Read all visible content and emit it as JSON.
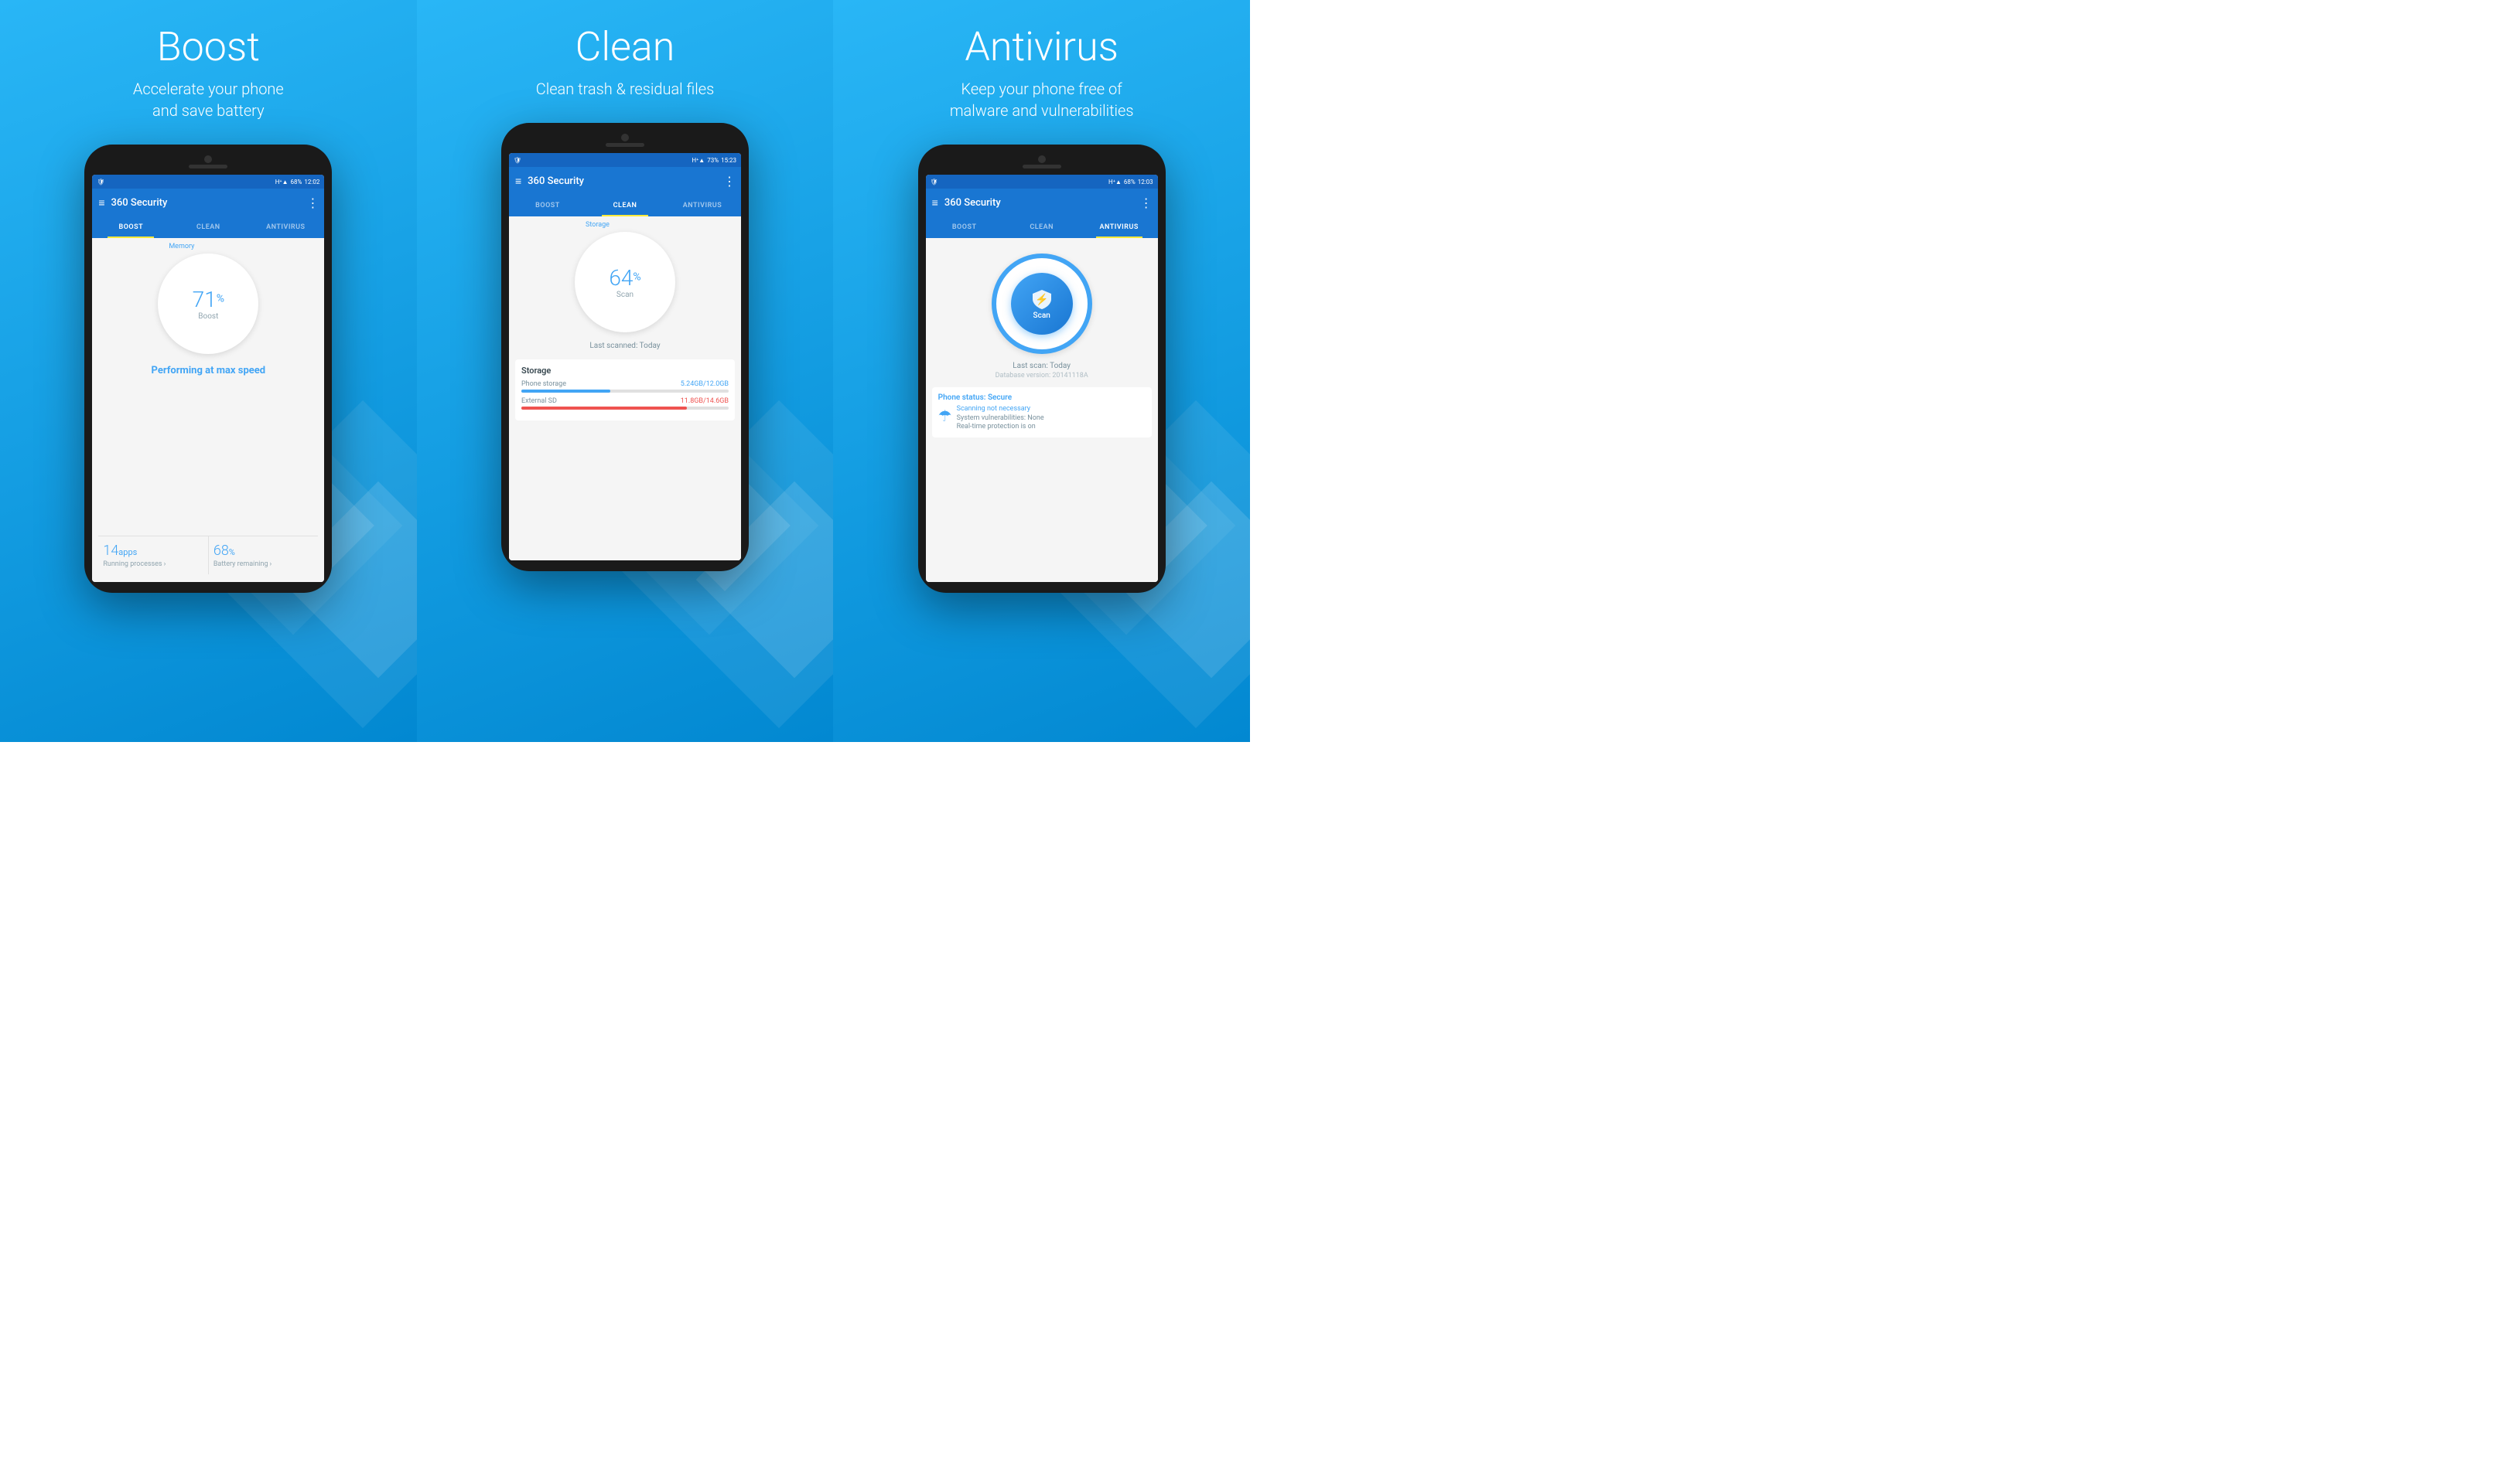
{
  "panels": [
    {
      "id": "boost",
      "title": "Boost",
      "subtitle": "Accelerate your phone\nand save battery",
      "app": {
        "title": "360 Security",
        "time": "12:02",
        "battery": "68%",
        "signal": "H+",
        "tabs": [
          "BOOST",
          "CLEAN",
          "ANTIVIRUS"
        ],
        "active_tab": 0,
        "circle_label": "Memory",
        "circle_value": "71",
        "circle_sub": "Boost",
        "status_text": "Performing at max speed",
        "stats": [
          {
            "value": "14",
            "unit": "apps",
            "label": "Running processes",
            "has_arrow": true
          },
          {
            "value": "68",
            "unit": "%",
            "label": "Battery remaining",
            "has_arrow": true
          }
        ]
      }
    },
    {
      "id": "clean",
      "title": "Clean",
      "subtitle": "Clean trash & residual files",
      "app": {
        "title": "360 Security",
        "time": "15:23",
        "battery": "73%",
        "signal": "H+",
        "tabs": [
          "BOOST",
          "CLEAN",
          "ANTIVIRUS"
        ],
        "active_tab": 1,
        "circle_label": "Storage",
        "circle_value": "64",
        "circle_sub": "Scan",
        "last_scanned": "Last scanned: Today",
        "storage_title": "Storage",
        "storage_items": [
          {
            "label": "Phone storage",
            "value": "5.24GB/12.0GB",
            "fill_pct": 43,
            "color": "blue"
          },
          {
            "label": "External SD",
            "value": "11.8GB/14.6GB",
            "fill_pct": 80,
            "color": "red"
          }
        ]
      }
    },
    {
      "id": "antivirus",
      "title": "Antivirus",
      "subtitle": "Keep your phone free of\nmalware and vulnerabilities",
      "app": {
        "title": "360 Security",
        "time": "12:03",
        "battery": "68%",
        "signal": "H+",
        "tabs": [
          "BOOST",
          "CLEAN",
          "ANTIVIRUS"
        ],
        "active_tab": 2,
        "scan_label": "Scan",
        "last_scan": "Last scan: Today",
        "db_version": "Database version: 20141118A",
        "phone_status_title": "Phone status: Secure",
        "scanning_status": "Scanning not necessary",
        "vulnerabilities": "System vulnerabilities: None",
        "realtime": "Real-time protection is on"
      }
    }
  ],
  "icons": {
    "hamburger": "≡",
    "dots": "⋮",
    "shield": "🛡",
    "bolt": "⚡",
    "umbrella": "☂"
  }
}
